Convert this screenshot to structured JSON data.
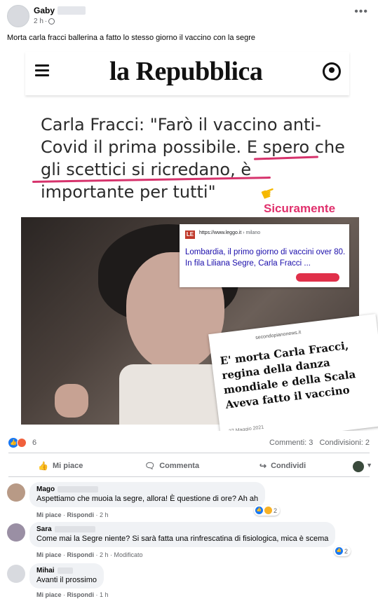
{
  "post": {
    "author": "Gaby",
    "time": "2 h",
    "dot": "·",
    "more_label": "•••",
    "text": "Morta carla fracci ballerina a fatto lo stesso giorno il vaccino con la segre"
  },
  "image": {
    "masthead": "la Repubblica",
    "headline": "Carla Fracci: \"Farò il vaccino anti-Covid il prima possibile. E spero che gli scettici si ricredano, è importante per tutti\"",
    "annotation": "Sicuramente",
    "leggo": {
      "logo": "LE",
      "url": "https://www.leggo.it",
      "url_path": " › milano",
      "title": "Lombardia, il primo giorno di vaccini over 80. In fila Liliana Segre, Carla Fracci ..."
    },
    "second": {
      "source": "secondopianonews.it",
      "title": "E' morta Carla Fracci, regina della danza mondiale e della Scala Aveva fatto il vaccino",
      "date": "27 Maggio 2021"
    }
  },
  "summary": {
    "reaction_count": "6",
    "comments": "Commenti: 3",
    "shares": "Condivisioni: 2"
  },
  "actions": {
    "like": "Mi piace",
    "comment": "Commenta",
    "share": "Condividi"
  },
  "comments": [
    {
      "name": "Mago",
      "text": "Aspettiamo che muoia la segre, allora! È questione di ore? Ah ah",
      "like": "Mi piace",
      "reply": "Rispondi",
      "time": "2 h",
      "reactions": "2"
    },
    {
      "name": "Sara",
      "text": "Come mai la Segre niente? Si sarà fatta una rinfrescatina di fisiologica, mica è scema",
      "like": "Mi piace",
      "reply": "Rispondi",
      "time": "2 h",
      "edited": "Modificato",
      "reactions": "2"
    },
    {
      "name": "Mihai",
      "text": "Avanti il prossimo",
      "like": "Mi piace",
      "reply": "Rispondi",
      "time": "1 h"
    }
  ]
}
